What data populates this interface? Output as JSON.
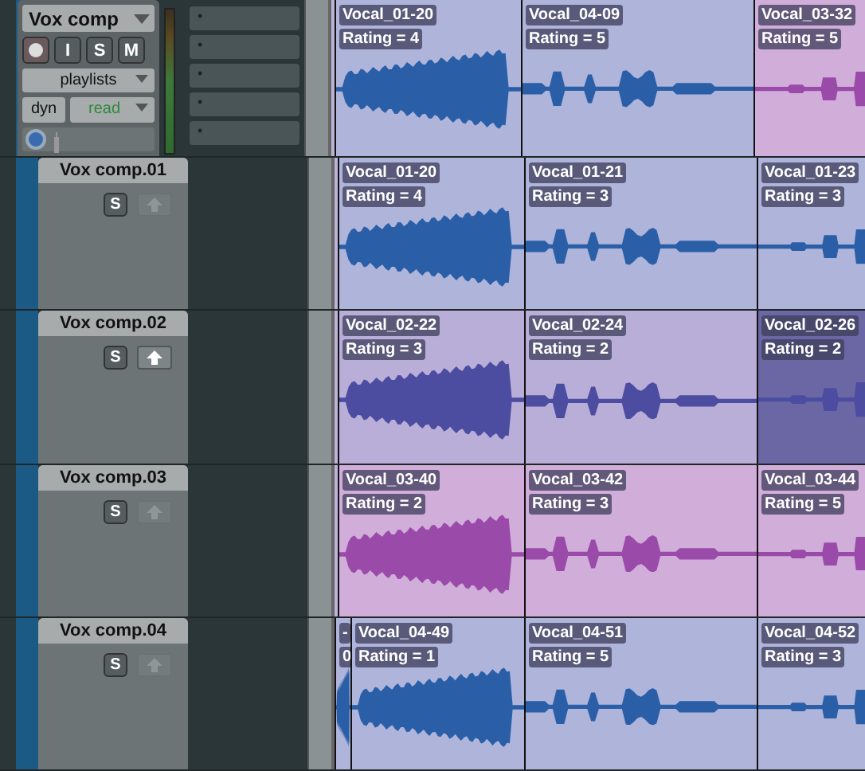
{
  "main_track": {
    "name": "Vox comp",
    "input_button": "I",
    "solo_button": "S",
    "mute_button": "M",
    "playlists_menu": "playlists",
    "dyn_label": "dyn",
    "automation_mode": "read",
    "inserts": [
      {
        "label": "•"
      },
      {
        "label": "•"
      },
      {
        "label": "•"
      },
      {
        "label": "•"
      },
      {
        "label": "•"
      }
    ],
    "clips": [
      {
        "name": "Vocal_01-20",
        "rating": "Rating = 4",
        "color": "#2a5fa8",
        "selected": false
      },
      {
        "name": "Vocal_04-09",
        "rating": "Rating = 5",
        "color": "#2a5fa8",
        "selected": false
      },
      {
        "name": "Vocal_03-32",
        "rating": "Rating = 5",
        "color": "#9a4aa8",
        "selected": false
      }
    ]
  },
  "playlists": [
    {
      "name": "Vox comp.01",
      "solo": "S",
      "promote_disabled": true,
      "clips": [
        {
          "name": "Vocal_01-20",
          "rating": "Rating = 4",
          "color": "#2a5fa8",
          "selected": false
        },
        {
          "name": "Vocal_01-21",
          "rating": "Rating = 3",
          "color": "#2a5fa8",
          "selected": false
        },
        {
          "name": "Vocal_01-23",
          "rating": "Rating = 3",
          "color": "#2a5fa8",
          "selected": false
        }
      ]
    },
    {
      "name": "Vox comp.02",
      "solo": "S",
      "promote_disabled": false,
      "clips": [
        {
          "name": "Vocal_02-22",
          "rating": "Rating = 3",
          "color": "#4c4ca0",
          "selected": false
        },
        {
          "name": "Vocal_02-24",
          "rating": "Rating = 2",
          "color": "#4c4ca0",
          "selected": false
        },
        {
          "name": "Vocal_02-26",
          "rating": "Rating = 2",
          "color": "#4c4ca0",
          "selected": true
        }
      ]
    },
    {
      "name": "Vox comp.03",
      "solo": "S",
      "promote_disabled": true,
      "clips": [
        {
          "name": "Vocal_03-40",
          "rating": "Rating = 2",
          "color": "#9a4aa8",
          "selected": false
        },
        {
          "name": "Vocal_03-42",
          "rating": "Rating = 3",
          "color": "#9a4aa8",
          "selected": false
        },
        {
          "name": "Vocal_03-44",
          "rating": "Rating = 5",
          "color": "#9a4aa8",
          "selected": false
        }
      ]
    },
    {
      "name": "Vox comp.04",
      "solo": "S",
      "promote_disabled": true,
      "clips": [
        {
          "name": "-",
          "rating": "0",
          "color": "#2a5fa8",
          "selected": false
        },
        {
          "name": "Vocal_04-49",
          "rating": "Rating = 1",
          "color": "#2a5fa8",
          "selected": false
        },
        {
          "name": "Vocal_04-51",
          "rating": "Rating = 5",
          "color": "#2a5fa8",
          "selected": false
        },
        {
          "name": "Vocal_04-52",
          "rating": "Rating = 3",
          "color": "#2a5fa8",
          "selected": false
        }
      ]
    }
  ]
}
